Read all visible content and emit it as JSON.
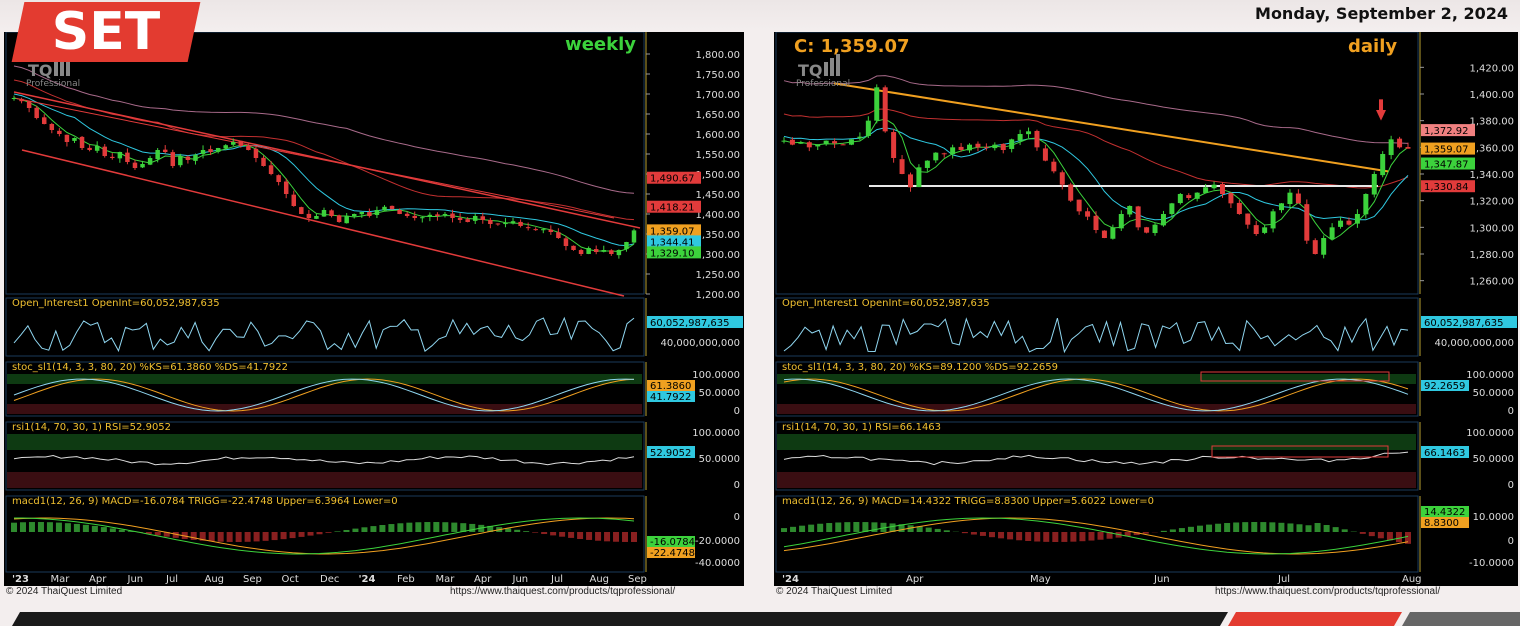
{
  "header": {
    "logo_text": "SET",
    "date_text": "Monday, September 2, 2024"
  },
  "left": {
    "timeframe": "weekly",
    "brand": "TQ",
    "brand_sub": "Professional",
    "price_axis": [
      "1,800.00",
      "1,750.00",
      "1,700.00",
      "1,650.00",
      "1,600.00",
      "1,550.00",
      "1,500.00",
      "1,450.00",
      "1,400.00",
      "1,350.00",
      "1,300.00",
      "1,250.00",
      "1,200.00"
    ],
    "price_labels": [
      {
        "text": "1,490.67",
        "value": 1490.67,
        "color": "#e23b3b"
      },
      {
        "text": "1,418.21",
        "value": 1418.21,
        "color": "#e23b3b"
      },
      {
        "text": "1,359.07",
        "value": 1359.07,
        "color": "#f0a020"
      },
      {
        "text": "1,344.41",
        "value": 1344.41,
        "color": "#2fc8e0"
      },
      {
        "text": "1,329.10",
        "value": 1329.1,
        "color": "#3cd23c"
      }
    ],
    "oi_title": "Open_Interest1 OpenInt=60,052,987,635",
    "oi_axis": [
      "60,052,987,635",
      "40,000,000,000"
    ],
    "stoch_title": "stoc_sl1(14, 3, 3, 80, 20) %KS=61.3860 %DS=41.7922",
    "stoch_axis": [
      "100.0000",
      "50.0000",
      "0"
    ],
    "stoch_labels": [
      "61.3860",
      "41.7922"
    ],
    "rsi_title": "rsi1(14, 70, 30, 1) RSI=52.9052",
    "rsi_axis": [
      "100.0000",
      "50.0000",
      "0"
    ],
    "rsi_label": "52.9052",
    "macd_title": "macd1(12, 26, 9) MACD=-16.0784 TRIGG=-22.4748 Upper=6.3964 Lower=0",
    "macd_axis": [
      "0",
      "-20.0000",
      "-40.0000"
    ],
    "macd_labels": [
      "-16.0784",
      "-22.4748"
    ],
    "time_axis": [
      "'23",
      "Mar",
      "Apr",
      "Jun",
      "Jul",
      "Aug",
      "Sep",
      "Oct",
      "Dec",
      "'24",
      "Feb",
      "Mar",
      "Apr",
      "Jun",
      "Jul",
      "Aug",
      "Sep"
    ],
    "copyright": "© 2024 ThaiQuest Limited",
    "url": "https://www.thaiquest.com/products/tqprofessional/"
  },
  "right": {
    "timeframe": "daily",
    "close_label": "C: 1,359.07",
    "brand": "TQ",
    "brand_sub": "Professional",
    "price_axis": [
      "1,420.00",
      "1,400.00",
      "1,380.00",
      "1,360.00",
      "1,340.00",
      "1,320.00",
      "1,300.00",
      "1,280.00",
      "1,260.00"
    ],
    "price_labels": [
      {
        "text": "1,372.92",
        "value": 1372.92,
        "color": "#f08080"
      },
      {
        "text": "1,359.07",
        "value": 1359.07,
        "color": "#f0a020"
      },
      {
        "text": "1,347.87",
        "value": 1347.87,
        "color": "#3cd23c"
      },
      {
        "text": "1,330.84",
        "value": 1330.84,
        "color": "#e23b3b"
      }
    ],
    "oi_title": "Open_Interest1 OpenInt=60,052,987,635",
    "oi_axis": [
      "60,052,987,635",
      "40,000,000,000"
    ],
    "stoch_title": "stoc_sl1(14, 3, 3, 80, 20) %KS=89.1200 %DS=92.2659",
    "stoch_axis": [
      "100.0000",
      "50.0000",
      "0"
    ],
    "stoch_labels": [
      "92.2659"
    ],
    "rsi_title": "rsi1(14, 70, 30, 1) RSI=66.1463",
    "rsi_axis": [
      "100.0000",
      "50.0000",
      "0"
    ],
    "rsi_label": "66.1463",
    "macd_title": "macd1(12, 26, 9) MACD=14.4322 TRIGG=8.8300 Upper=5.6022 Lower=0",
    "macd_axis": [
      "10.0000",
      "0",
      "-10.0000"
    ],
    "macd_labels": [
      "14.4322",
      "8.8300"
    ],
    "time_axis": [
      "'24",
      "Apr",
      "May",
      "Jun",
      "Jul",
      "Aug"
    ],
    "copyright": "© 2024 ThaiQuest Limited",
    "url": "https://www.thaiquest.com/products/tqprofessional/"
  },
  "chart_data": [
    {
      "type": "candlestick",
      "title": "weekly",
      "ylim": [
        1200,
        1800
      ],
      "close": [
        1690,
        1682,
        1665,
        1640,
        1625,
        1610,
        1600,
        1580,
        1590,
        1565,
        1560,
        1570,
        1545,
        1540,
        1555,
        1530,
        1515,
        1525,
        1540,
        1560,
        1555,
        1520,
        1545,
        1535,
        1548,
        1560,
        1555,
        1565,
        1572,
        1580,
        1570,
        1560,
        1540,
        1520,
        1500,
        1480,
        1450,
        1420,
        1400,
        1390,
        1395,
        1410,
        1395,
        1380,
        1395,
        1400,
        1405,
        1395,
        1410,
        1418,
        1412,
        1400,
        1395,
        1390,
        1392,
        1398,
        1395,
        1400,
        1390,
        1385,
        1380,
        1395,
        1385,
        1375,
        1375,
        1378,
        1382,
        1370,
        1365,
        1360,
        1362,
        1355,
        1340,
        1320,
        1310,
        1300,
        1315,
        1305,
        1310,
        1300,
        1310,
        1330,
        1359
      ],
      "series": [
        {
          "name": "ma_fast",
          "color": "#3cd23c"
        },
        {
          "name": "ma_mid",
          "color": "#2fc8e0"
        },
        {
          "name": "ma_slow",
          "color": "#e23b3b"
        },
        {
          "name": "ma_long",
          "color": "#c77aa0"
        }
      ]
    },
    {
      "type": "candlestick",
      "title": "daily",
      "ylim": [
        1250,
        1430
      ],
      "close": [
        1365,
        1362,
        1364,
        1360,
        1362,
        1365,
        1363,
        1362,
        1366,
        1368,
        1380,
        1405,
        1372,
        1352,
        1340,
        1330,
        1345,
        1350,
        1356,
        1355,
        1360,
        1358,
        1362,
        1360,
        1360,
        1362,
        1358,
        1366,
        1370,
        1372,
        1360,
        1350,
        1342,
        1332,
        1320,
        1312,
        1308,
        1298,
        1292,
        1300,
        1310,
        1316,
        1300,
        1296,
        1302,
        1310,
        1318,
        1325,
        1322,
        1326,
        1330,
        1332,
        1325,
        1318,
        1310,
        1302,
        1295,
        1300,
        1312,
        1318,
        1326,
        1318,
        1290,
        1280,
        1292,
        1300,
        1305,
        1302,
        1310,
        1325,
        1340,
        1355,
        1366,
        1360,
        1359
      ]
    }
  ]
}
